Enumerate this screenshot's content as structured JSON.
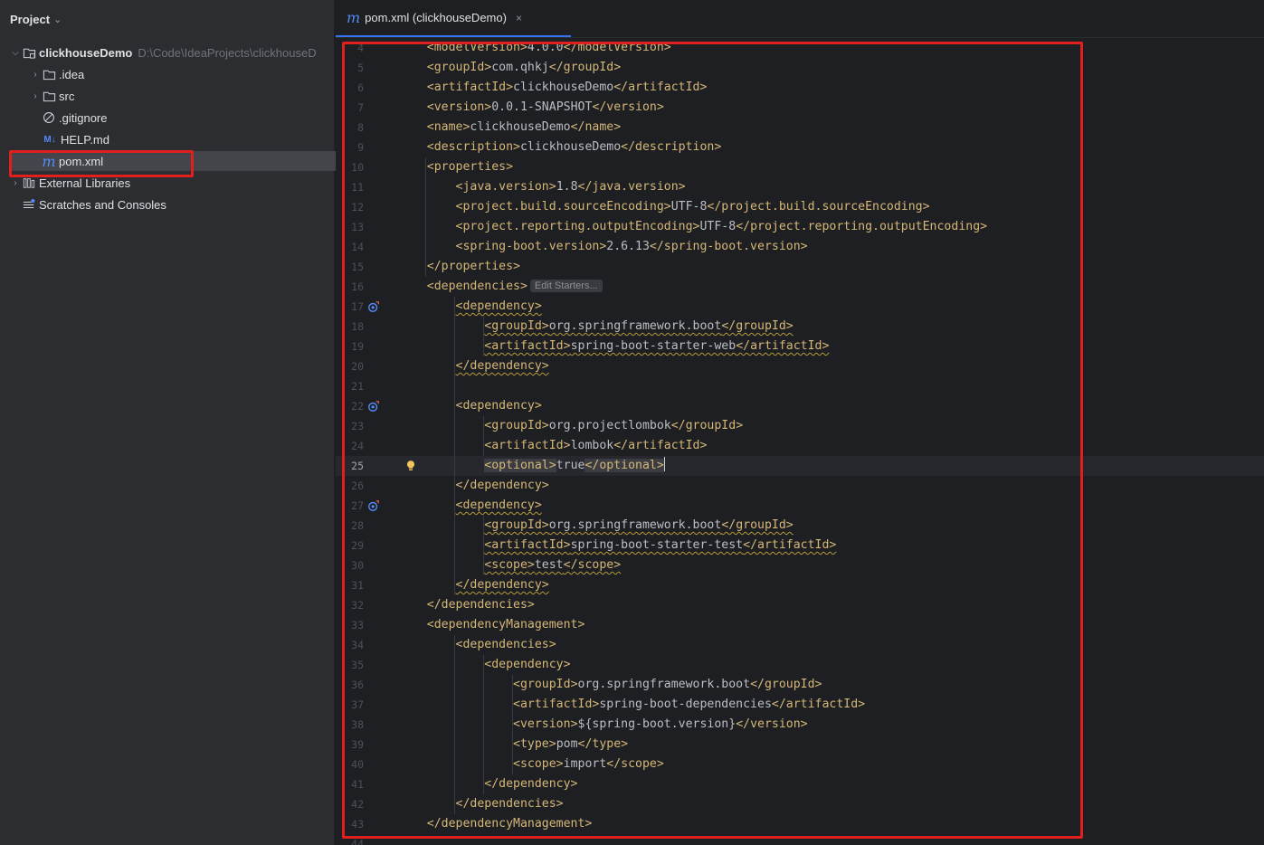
{
  "project_panel": {
    "title": "Project",
    "tree": [
      {
        "label": "clickhouseDemo",
        "path": "D:\\Code\\IdeaProjects\\clickhouseD",
        "icon": "module-folder-icon",
        "expanded": true
      },
      {
        "label": ".idea",
        "icon": "folder-icon"
      },
      {
        "label": "src",
        "icon": "folder-icon"
      },
      {
        "label": ".gitignore",
        "icon": "ignore-file-icon"
      },
      {
        "label": "HELP.md",
        "icon": "markdown-icon",
        "icon_text": "M↓"
      },
      {
        "label": "pom.xml",
        "icon": "maven-icon",
        "icon_text": "m",
        "selected": true
      },
      {
        "label": "External Libraries",
        "icon": "library-icon"
      },
      {
        "label": "Scratches and Consoles",
        "icon": "scratches-icon"
      }
    ]
  },
  "editor": {
    "tab": {
      "label": "pom.xml (clickhouseDemo)",
      "icon_text": "m",
      "close": "×"
    },
    "inlay_hint": "Edit Starters...",
    "current_line": 25,
    "lines": [
      {
        "n": "4",
        "t": "    <modelVersion>4.0.0</modelVersion>"
      },
      {
        "n": "5",
        "t": "    <groupId>com.qhkj</groupId>"
      },
      {
        "n": "6",
        "t": "    <artifactId>clickhouseDemo</artifactId>"
      },
      {
        "n": "7",
        "t": "    <version>0.0.1-SNAPSHOT</version>"
      },
      {
        "n": "8",
        "t": "    <name>clickhouseDemo</name>"
      },
      {
        "n": "9",
        "t": "    <description>clickhouseDemo</description>"
      },
      {
        "n": "10",
        "t": "    <properties>"
      },
      {
        "n": "11",
        "t": "        <java.version>1.8</java.version>"
      },
      {
        "n": "12",
        "t": "        <project.build.sourceEncoding>UTF-8</project.build.sourceEncoding>"
      },
      {
        "n": "13",
        "t": "        <project.reporting.outputEncoding>UTF-8</project.reporting.outputEncoding>"
      },
      {
        "n": "14",
        "t": "        <spring-boot.version>2.6.13</spring-boot.version>"
      },
      {
        "n": "15",
        "t": "    </properties>"
      },
      {
        "n": "16",
        "t": "    <dependencies>",
        "inlay": true
      },
      {
        "n": "17",
        "t": "        <dependency>",
        "gutter": true,
        "warn": true
      },
      {
        "n": "18",
        "t": "            <groupId>org.springframework.boot</groupId>",
        "warn": true
      },
      {
        "n": "19",
        "t": "            <artifactId>spring-boot-starter-web</artifactId>",
        "warn": true
      },
      {
        "n": "20",
        "t": "        </dependency>",
        "warn": true
      },
      {
        "n": "21",
        "t": ""
      },
      {
        "n": "22",
        "t": "        <dependency>",
        "gutter": true
      },
      {
        "n": "23",
        "t": "            <groupId>org.projectlombok</groupId>"
      },
      {
        "n": "24",
        "t": "            <artifactId>lombok</artifactId>"
      },
      {
        "n": "25",
        "t": "            <optional>true</optional>",
        "bulb": true,
        "caret": true
      },
      {
        "n": "26",
        "t": "        </dependency>"
      },
      {
        "n": "27",
        "t": "        <dependency>",
        "gutter": true,
        "warn": true
      },
      {
        "n": "28",
        "t": "            <groupId>org.springframework.boot</groupId>",
        "warn": true
      },
      {
        "n": "29",
        "t": "            <artifactId>spring-boot-starter-test</artifactId>",
        "warn": true
      },
      {
        "n": "30",
        "t": "            <scope>test</scope>",
        "warn": true
      },
      {
        "n": "31",
        "t": "        </dependency>",
        "warn": true
      },
      {
        "n": "32",
        "t": "    </dependencies>"
      },
      {
        "n": "33",
        "t": "    <dependencyManagement>"
      },
      {
        "n": "34",
        "t": "        <dependencies>"
      },
      {
        "n": "35",
        "t": "            <dependency>"
      },
      {
        "n": "36",
        "t": "                <groupId>org.springframework.boot</groupId>"
      },
      {
        "n": "37",
        "t": "                <artifactId>spring-boot-dependencies</artifactId>"
      },
      {
        "n": "38",
        "t": "                <version>${spring-boot.version}</version>"
      },
      {
        "n": "39",
        "t": "                <type>pom</type>"
      },
      {
        "n": "40",
        "t": "                <scope>import</scope>"
      },
      {
        "n": "41",
        "t": "            </dependency>"
      },
      {
        "n": "42",
        "t": "        </dependencies>"
      },
      {
        "n": "43",
        "t": "    </dependencyManagement>"
      },
      {
        "n": "44",
        "t": ""
      }
    ]
  },
  "colors": {
    "accent": "#3574f0",
    "tag": "#d5b778",
    "highlight_box": "#e11f1f",
    "warning_underline": "#b59a3a"
  }
}
